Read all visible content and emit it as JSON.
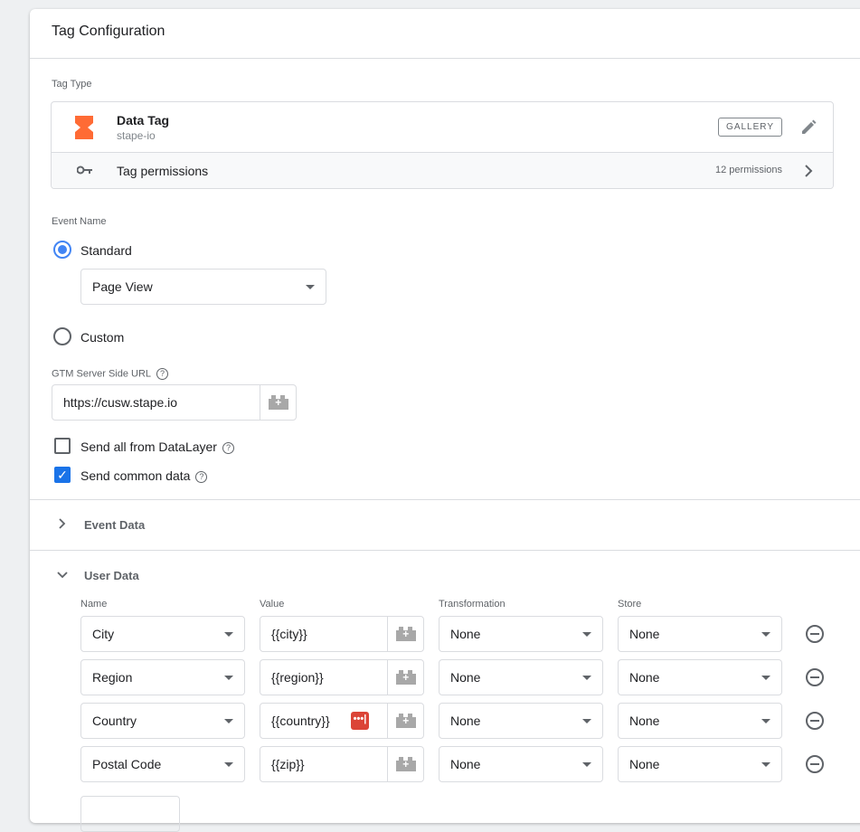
{
  "header": {
    "title": "Tag Configuration"
  },
  "tag_type": {
    "label": "Tag Type",
    "name": "Data Tag",
    "vendor": "stape-io",
    "gallery": "GALLERY",
    "permissions_label": "Tag permissions",
    "permissions_count": "12 permissions",
    "accent": "#ff6b35"
  },
  "event_name": {
    "label": "Event Name",
    "standard": "Standard",
    "standard_value": "Page View",
    "custom": "Custom",
    "selected": "Standard"
  },
  "server_url": {
    "label": "GTM Server Side URL",
    "value": "https://cusw.stape.io",
    "help": "?"
  },
  "checkboxes": [
    {
      "label": "Send all from DataLayer",
      "checked": false
    },
    {
      "label": "Send common data",
      "checked": true
    }
  ],
  "sections": {
    "event_data": "Event Data",
    "user_data": "User Data"
  },
  "user_data": {
    "columns": [
      "Name",
      "Value",
      "Transformation",
      "Store"
    ],
    "rows": [
      {
        "name": "City",
        "value": "{{city}}",
        "transformation": "None",
        "store": "None"
      },
      {
        "name": "Region",
        "value": "{{region}}",
        "transformation": "None",
        "store": "None"
      },
      {
        "name": "Country",
        "value": "{{country}}",
        "transformation": "None",
        "store": "None",
        "badge": "•••|"
      },
      {
        "name": "Postal Code",
        "value": "{{zip}}",
        "transformation": "None",
        "store": "None"
      }
    ]
  }
}
